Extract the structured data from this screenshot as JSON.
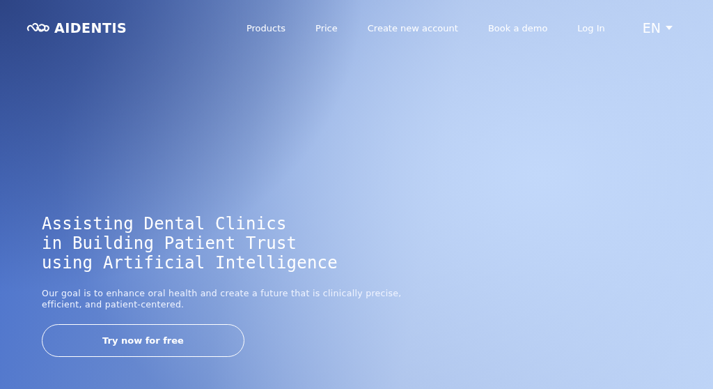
{
  "header": {
    "logo": "AIDENTIS",
    "nav": [
      {
        "label": "Products"
      },
      {
        "label": "Price"
      },
      {
        "label": "Create new account"
      },
      {
        "label": "Book a demo"
      },
      {
        "label": "Log In"
      }
    ],
    "language": "EN"
  },
  "hero": {
    "title": "Assisting Dental Clinics\nin Building Patient Trust\nusing Artificial Intelligence",
    "subtitle": "Our goal is to enhance oral health and create a future that is clinically precise, efficient, and patient-centered.",
    "button": "Try now for free"
  }
}
